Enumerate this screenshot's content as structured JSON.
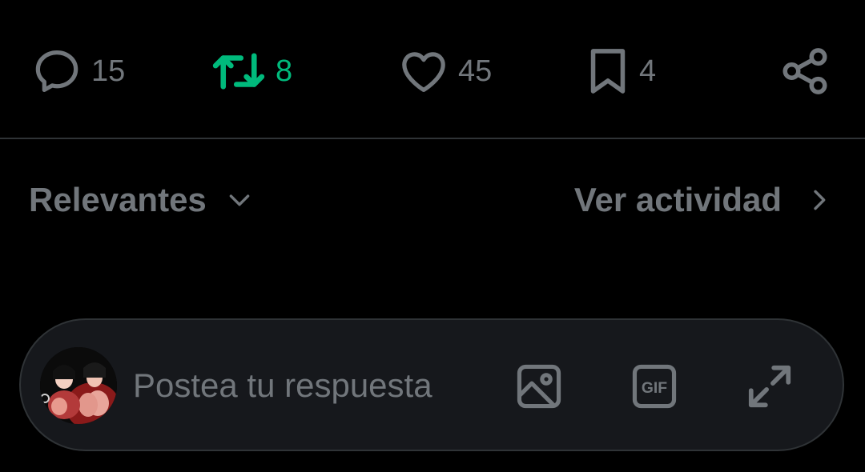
{
  "actions": {
    "reply": {
      "icon": "reply-bubble-icon",
      "count": "15"
    },
    "repost": {
      "icon": "repost-icon",
      "count": "8",
      "active": true,
      "active_color": "#00ba7c"
    },
    "like": {
      "icon": "heart-icon",
      "count": "45"
    },
    "bookmark": {
      "icon": "bookmark-icon",
      "count": "4"
    },
    "share": {
      "icon": "share-icon"
    }
  },
  "replies_header": {
    "sort_label": "Relevantes",
    "sort_icon": "chevron-down-icon",
    "activity_label": "Ver actividad",
    "activity_icon": "chevron-right-icon"
  },
  "composer": {
    "placeholder": "Postea tu respuesta",
    "value": "",
    "avatar": "user-avatar",
    "tools": [
      "image-icon",
      "gif-icon",
      "expand-icon"
    ],
    "gif_label": "GIF"
  },
  "colors": {
    "background": "#000000",
    "muted": "#71767b",
    "accent_green": "#00ba7c",
    "divider": "#2f3336",
    "composer_bg": "#16181c"
  }
}
